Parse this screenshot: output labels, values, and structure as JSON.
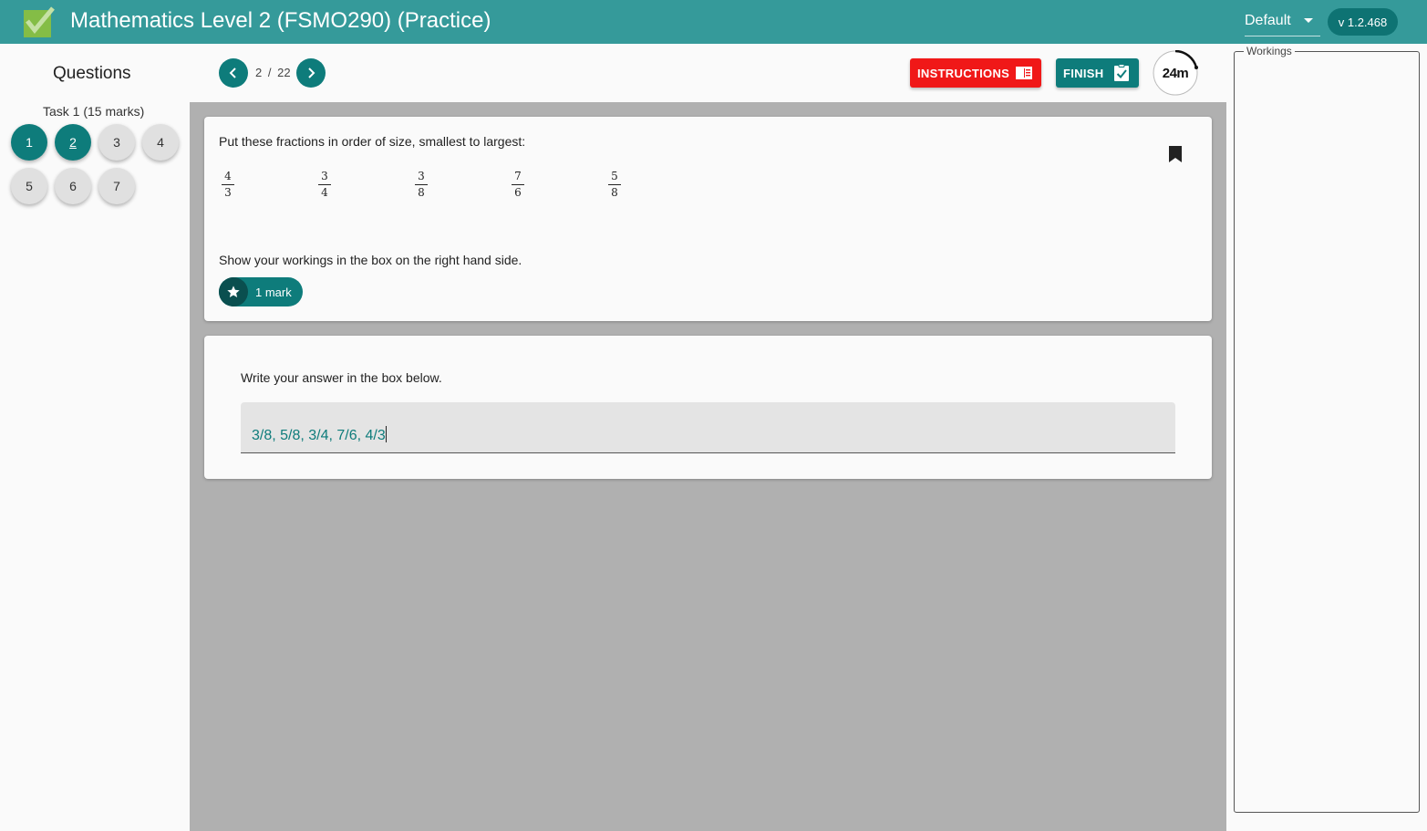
{
  "header": {
    "title": "Mathematics Level 2 (FSMO290) (Practice)",
    "theme_select": "Default",
    "version": "v 1.2.468"
  },
  "sidebar": {
    "heading": "Questions",
    "task_label": "Task 1 (15 marks)",
    "questions": [
      {
        "label": "1",
        "state": "answered"
      },
      {
        "label": "2",
        "state": "current"
      },
      {
        "label": "3",
        "state": "unanswered"
      },
      {
        "label": "4",
        "state": "unanswered"
      },
      {
        "label": "5",
        "state": "unanswered"
      },
      {
        "label": "6",
        "state": "unanswered"
      },
      {
        "label": "7",
        "state": "unanswered"
      }
    ]
  },
  "toolbar": {
    "current_page": "2",
    "separator": "/",
    "total_pages": "22",
    "instructions_label": "INSTRUCTIONS",
    "finish_label": "FINISH",
    "timer": "24m",
    "timer_icon": "countdown-ring"
  },
  "question": {
    "prompt": "Put these fractions in order of size, smallest to largest:",
    "fractions": [
      {
        "num": "4",
        "den": "3"
      },
      {
        "num": "3",
        "den": "4"
      },
      {
        "num": "3",
        "den": "8"
      },
      {
        "num": "7",
        "den": "6"
      },
      {
        "num": "5",
        "den": "8"
      }
    ],
    "workings_instruction": "Show your workings in the box on the right hand side.",
    "marks_label": "1 mark"
  },
  "answer": {
    "prompt": "Write your answer in the box below.",
    "value": "3/8, 5/8, 3/4, 7/6, 4/3"
  },
  "workings": {
    "legend": "Workings"
  },
  "colors": {
    "header_bg": "#359a9a",
    "primary": "#0e7c7b",
    "instructions_btn": "#f01818",
    "content_bg": "#b0b0b0"
  }
}
